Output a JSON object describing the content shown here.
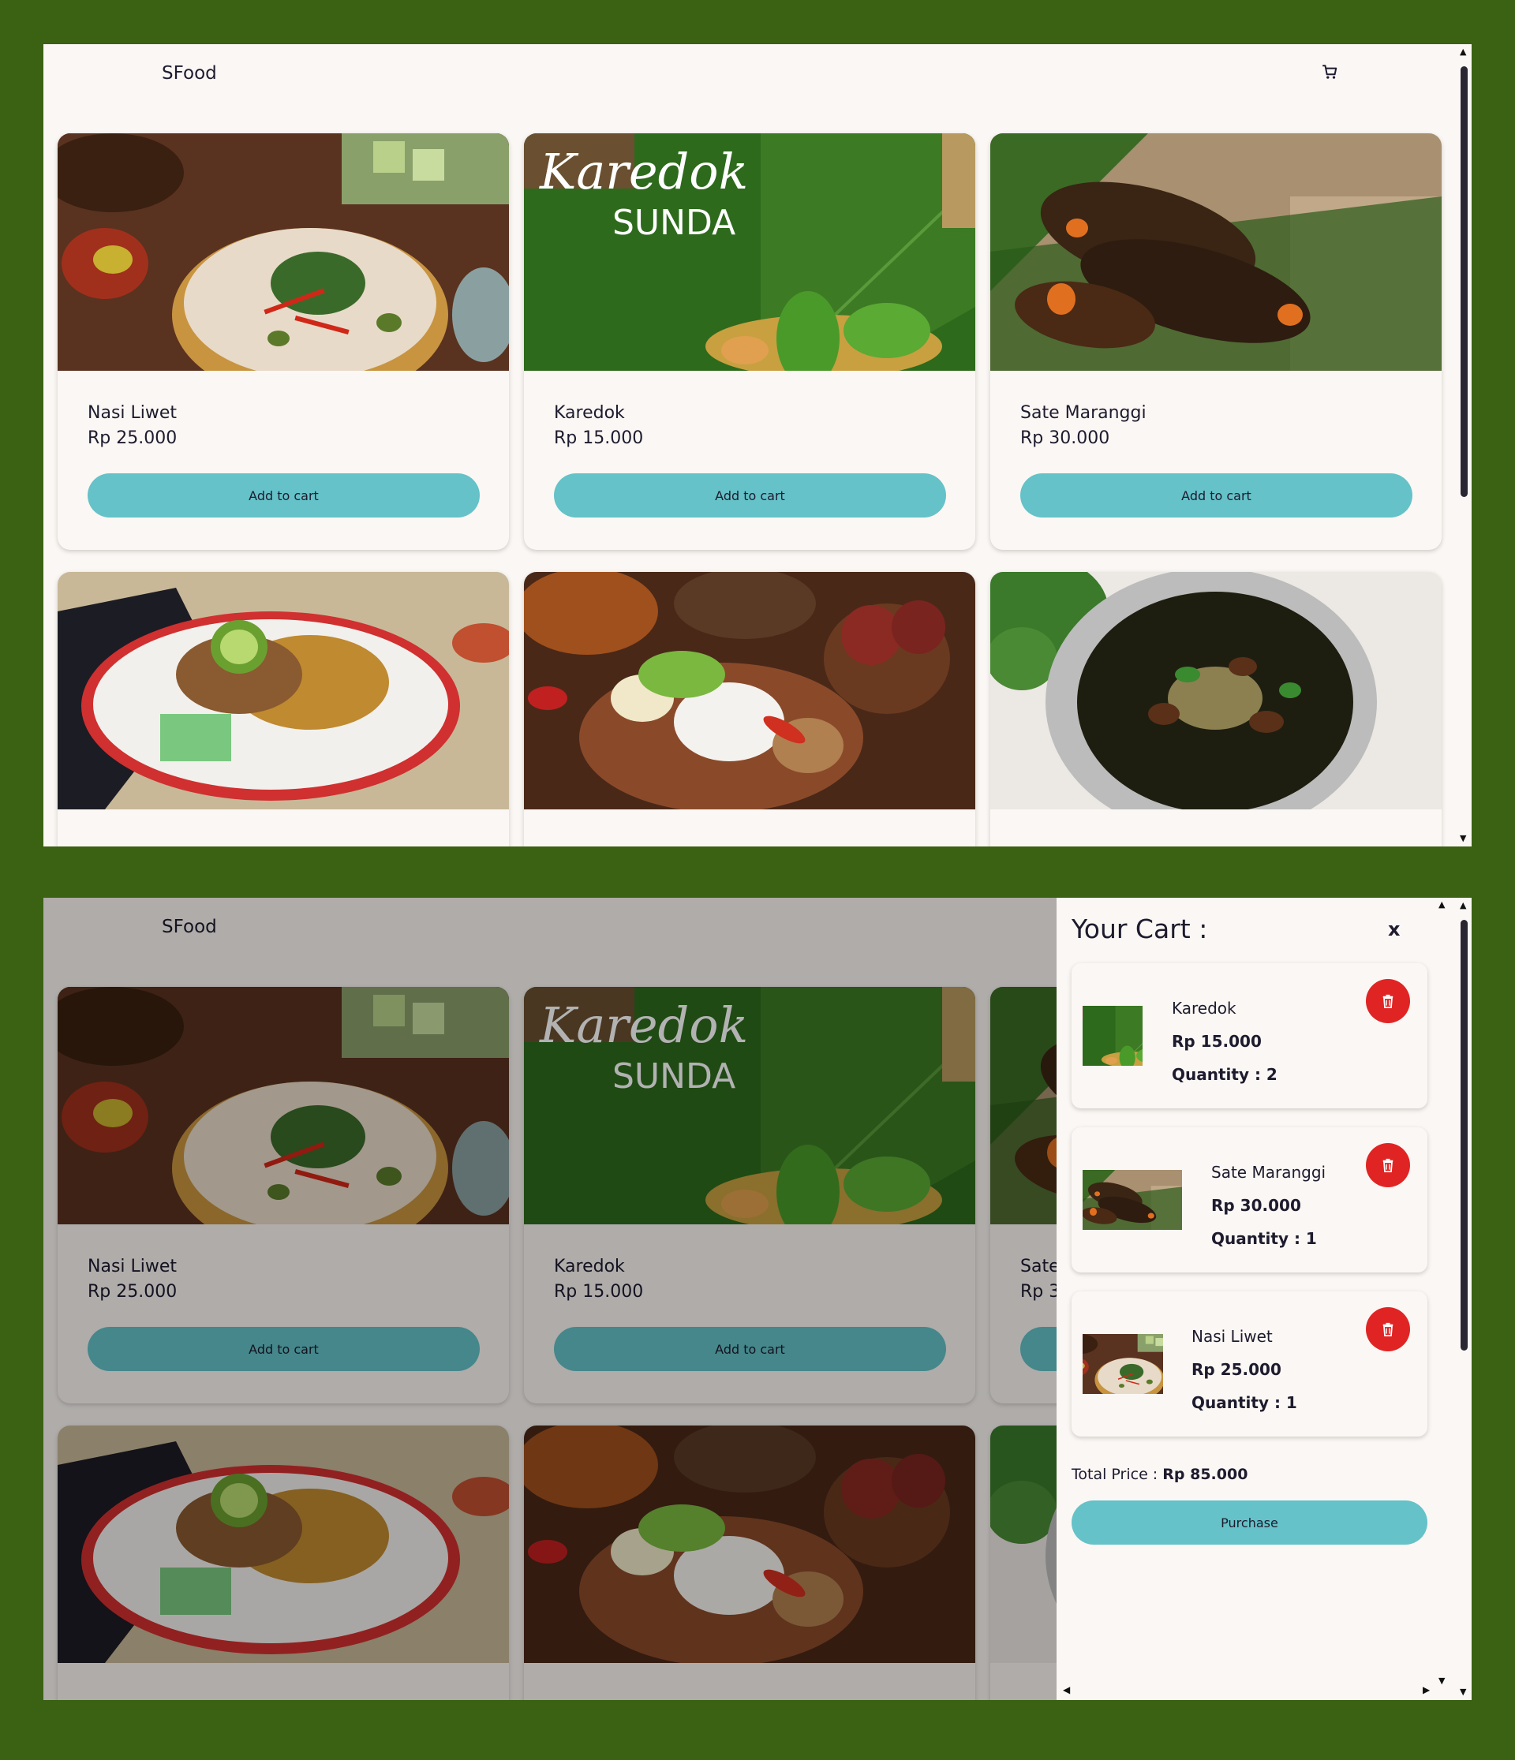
{
  "colors": {
    "page_background": "#3a6212",
    "surface": "#fbf7f4",
    "accent_button": "#64c2c8",
    "delete_button": "#e02424",
    "text": "#1e1b2e"
  },
  "header": {
    "brand": "SFood",
    "cart_icon": "shopping-cart-icon"
  },
  "products": [
    {
      "name": "Nasi Liwet",
      "price": "Rp 25.000",
      "button": "Add to cart"
    },
    {
      "name": "Karedok",
      "price": "Rp 15.000",
      "button": "Add to cart"
    },
    {
      "name": "Sate Maranggi",
      "price": "Rp 30.000",
      "button": "Add to cart"
    }
  ],
  "karedok_image_text": {
    "line1": "Karedok",
    "line2": "SUNDA"
  },
  "cart": {
    "title": "Your Cart :",
    "close_label": "x",
    "quantity_prefix": "Quantity : ",
    "delete_icon": "trash-icon",
    "items": [
      {
        "name": "Karedok",
        "price": "Rp 15.000",
        "quantity": "Quantity : 2"
      },
      {
        "name": "Sate Maranggi",
        "price": "Rp 30.000",
        "quantity": "Quantity : 1"
      },
      {
        "name": "Nasi Liwet",
        "price": "Rp 25.000",
        "quantity": "Quantity : 1"
      }
    ],
    "total_label": "Total Price :",
    "total_value": "Rp 85.000",
    "purchase_label": "Purchase"
  },
  "bottom_partial_card": {
    "name_fragment": "Sate",
    "price_fragment": "Rp 3"
  }
}
